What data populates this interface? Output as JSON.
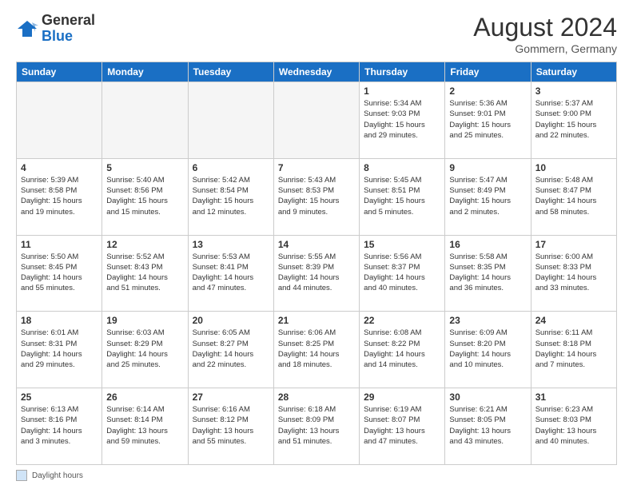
{
  "logo": {
    "general": "General",
    "blue": "Blue"
  },
  "title": "August 2024",
  "location": "Gommern, Germany",
  "days_of_week": [
    "Sunday",
    "Monday",
    "Tuesday",
    "Wednesday",
    "Thursday",
    "Friday",
    "Saturday"
  ],
  "footer": {
    "box_label": "Daylight hours"
  },
  "weeks": [
    [
      {
        "day": "",
        "info": ""
      },
      {
        "day": "",
        "info": ""
      },
      {
        "day": "",
        "info": ""
      },
      {
        "day": "",
        "info": ""
      },
      {
        "day": "1",
        "info": "Sunrise: 5:34 AM\nSunset: 9:03 PM\nDaylight: 15 hours\nand 29 minutes."
      },
      {
        "day": "2",
        "info": "Sunrise: 5:36 AM\nSunset: 9:01 PM\nDaylight: 15 hours\nand 25 minutes."
      },
      {
        "day": "3",
        "info": "Sunrise: 5:37 AM\nSunset: 9:00 PM\nDaylight: 15 hours\nand 22 minutes."
      }
    ],
    [
      {
        "day": "4",
        "info": "Sunrise: 5:39 AM\nSunset: 8:58 PM\nDaylight: 15 hours\nand 19 minutes."
      },
      {
        "day": "5",
        "info": "Sunrise: 5:40 AM\nSunset: 8:56 PM\nDaylight: 15 hours\nand 15 minutes."
      },
      {
        "day": "6",
        "info": "Sunrise: 5:42 AM\nSunset: 8:54 PM\nDaylight: 15 hours\nand 12 minutes."
      },
      {
        "day": "7",
        "info": "Sunrise: 5:43 AM\nSunset: 8:53 PM\nDaylight: 15 hours\nand 9 minutes."
      },
      {
        "day": "8",
        "info": "Sunrise: 5:45 AM\nSunset: 8:51 PM\nDaylight: 15 hours\nand 5 minutes."
      },
      {
        "day": "9",
        "info": "Sunrise: 5:47 AM\nSunset: 8:49 PM\nDaylight: 15 hours\nand 2 minutes."
      },
      {
        "day": "10",
        "info": "Sunrise: 5:48 AM\nSunset: 8:47 PM\nDaylight: 14 hours\nand 58 minutes."
      }
    ],
    [
      {
        "day": "11",
        "info": "Sunrise: 5:50 AM\nSunset: 8:45 PM\nDaylight: 14 hours\nand 55 minutes."
      },
      {
        "day": "12",
        "info": "Sunrise: 5:52 AM\nSunset: 8:43 PM\nDaylight: 14 hours\nand 51 minutes."
      },
      {
        "day": "13",
        "info": "Sunrise: 5:53 AM\nSunset: 8:41 PM\nDaylight: 14 hours\nand 47 minutes."
      },
      {
        "day": "14",
        "info": "Sunrise: 5:55 AM\nSunset: 8:39 PM\nDaylight: 14 hours\nand 44 minutes."
      },
      {
        "day": "15",
        "info": "Sunrise: 5:56 AM\nSunset: 8:37 PM\nDaylight: 14 hours\nand 40 minutes."
      },
      {
        "day": "16",
        "info": "Sunrise: 5:58 AM\nSunset: 8:35 PM\nDaylight: 14 hours\nand 36 minutes."
      },
      {
        "day": "17",
        "info": "Sunrise: 6:00 AM\nSunset: 8:33 PM\nDaylight: 14 hours\nand 33 minutes."
      }
    ],
    [
      {
        "day": "18",
        "info": "Sunrise: 6:01 AM\nSunset: 8:31 PM\nDaylight: 14 hours\nand 29 minutes."
      },
      {
        "day": "19",
        "info": "Sunrise: 6:03 AM\nSunset: 8:29 PM\nDaylight: 14 hours\nand 25 minutes."
      },
      {
        "day": "20",
        "info": "Sunrise: 6:05 AM\nSunset: 8:27 PM\nDaylight: 14 hours\nand 22 minutes."
      },
      {
        "day": "21",
        "info": "Sunrise: 6:06 AM\nSunset: 8:25 PM\nDaylight: 14 hours\nand 18 minutes."
      },
      {
        "day": "22",
        "info": "Sunrise: 6:08 AM\nSunset: 8:22 PM\nDaylight: 14 hours\nand 14 minutes."
      },
      {
        "day": "23",
        "info": "Sunrise: 6:09 AM\nSunset: 8:20 PM\nDaylight: 14 hours\nand 10 minutes."
      },
      {
        "day": "24",
        "info": "Sunrise: 6:11 AM\nSunset: 8:18 PM\nDaylight: 14 hours\nand 7 minutes."
      }
    ],
    [
      {
        "day": "25",
        "info": "Sunrise: 6:13 AM\nSunset: 8:16 PM\nDaylight: 14 hours\nand 3 minutes."
      },
      {
        "day": "26",
        "info": "Sunrise: 6:14 AM\nSunset: 8:14 PM\nDaylight: 13 hours\nand 59 minutes."
      },
      {
        "day": "27",
        "info": "Sunrise: 6:16 AM\nSunset: 8:12 PM\nDaylight: 13 hours\nand 55 minutes."
      },
      {
        "day": "28",
        "info": "Sunrise: 6:18 AM\nSunset: 8:09 PM\nDaylight: 13 hours\nand 51 minutes."
      },
      {
        "day": "29",
        "info": "Sunrise: 6:19 AM\nSunset: 8:07 PM\nDaylight: 13 hours\nand 47 minutes."
      },
      {
        "day": "30",
        "info": "Sunrise: 6:21 AM\nSunset: 8:05 PM\nDaylight: 13 hours\nand 43 minutes."
      },
      {
        "day": "31",
        "info": "Sunrise: 6:23 AM\nSunset: 8:03 PM\nDaylight: 13 hours\nand 40 minutes."
      }
    ]
  ]
}
